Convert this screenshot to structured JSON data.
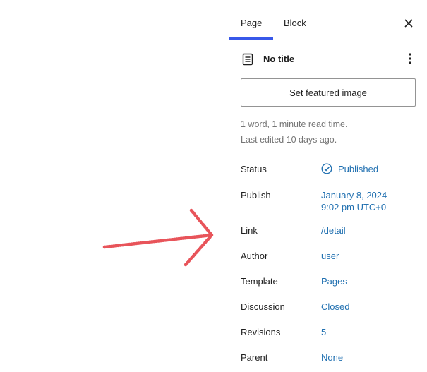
{
  "tabs": [
    {
      "label": "Page"
    },
    {
      "label": "Block"
    }
  ],
  "document": {
    "title": "No title",
    "featured_image_label": "Set featured image",
    "word_count": "1 word, 1 minute read time.",
    "last_edited": "Last edited 10 days ago."
  },
  "fields": {
    "status": {
      "label": "Status",
      "value": "Published"
    },
    "publish": {
      "label": "Publish",
      "date": "January 8, 2024",
      "time": "9:02 pm UTC+0"
    },
    "link": {
      "label": "Link",
      "value": "/detail"
    },
    "author": {
      "label": "Author",
      "value": "user"
    },
    "template": {
      "label": "Template",
      "value": "Pages"
    },
    "discussion": {
      "label": "Discussion",
      "value": "Closed"
    },
    "revisions": {
      "label": "Revisions",
      "value": "5"
    },
    "parent": {
      "label": "Parent",
      "value": "None"
    }
  },
  "colors": {
    "accent": "#3858e9",
    "link": "#2271b1",
    "annotation_arrow": "#e8545a"
  },
  "icons": {
    "close": "close-icon",
    "document": "document-icon",
    "more": "more-vertical-icon",
    "status": "published-check-icon"
  }
}
